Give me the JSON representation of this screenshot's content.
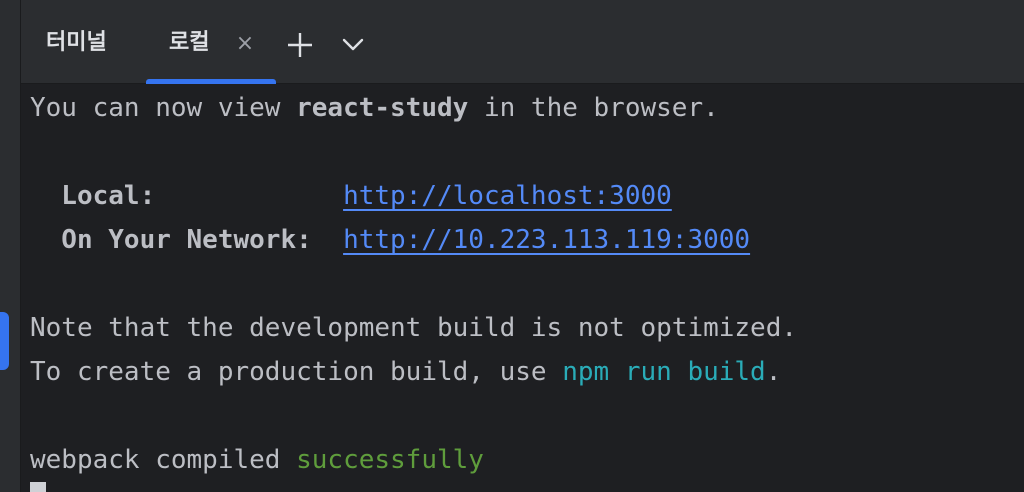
{
  "tabs": {
    "terminal_label": "터미널",
    "local_label": "로컬",
    "close_glyph": "×"
  },
  "output": {
    "line1_a": "You can now view ",
    "line1_app": "react-study",
    "line1_b": " in the browser.",
    "local_label": "  Local:            ",
    "local_url": "http://localhost:3000",
    "network_label": "  On Your Network:  ",
    "network_url": "http://10.223.113.119:3000",
    "note_line": "Note that the development build is not optimized.",
    "create_a": "To create a production build, use ",
    "create_cmd": "npm run build",
    "create_b": ".",
    "webpack_a": "webpack compiled ",
    "webpack_status": "successfully"
  },
  "colors": {
    "background": "#1e1f22",
    "accent": "#3574f0",
    "link": "#548af7",
    "command": "#2aacb8",
    "success": "#5f9d3c"
  }
}
